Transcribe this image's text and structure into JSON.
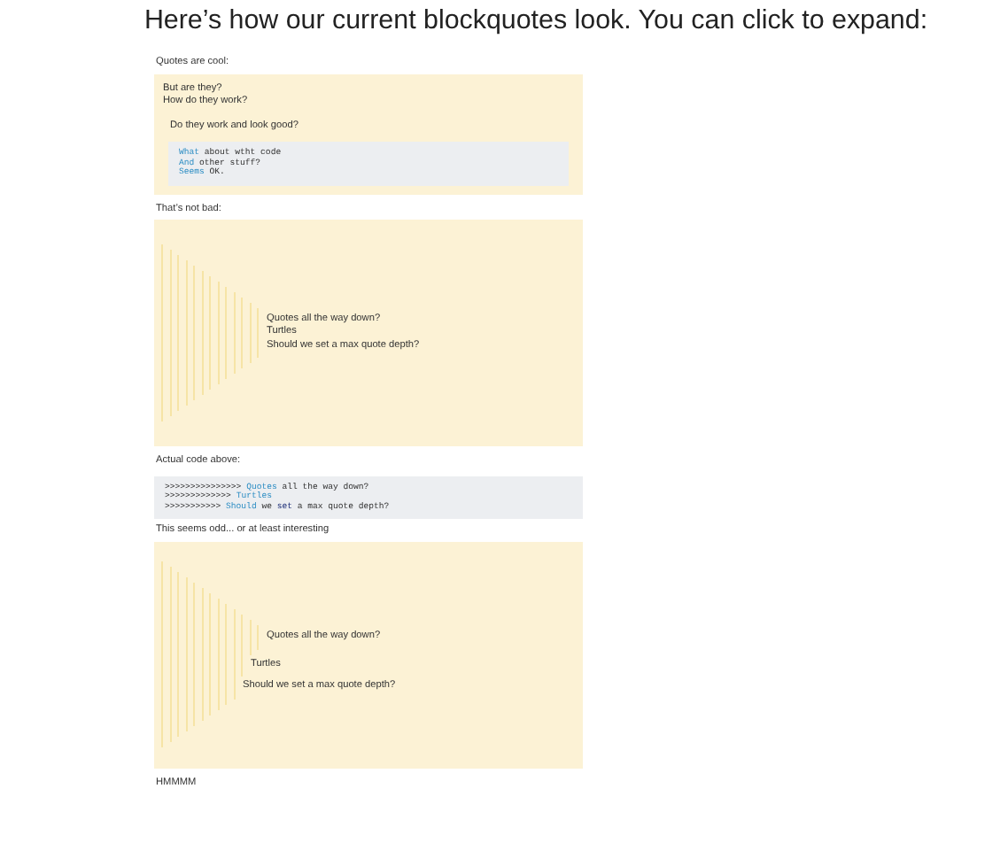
{
  "heading": "Here’s how our current blockquotes look. You can click to expand:",
  "content": [
    {
      "kind": "text",
      "text": "Quotes are cool:"
    },
    {
      "kind": "quote",
      "children": [
        {
          "kind": "text",
          "text": "But are they?"
        },
        {
          "kind": "text",
          "text": "How do they work?"
        },
        {
          "kind": "quote",
          "children": [
            {
              "kind": "text",
              "text": "Do they work and look good?"
            },
            {
              "kind": "code",
              "lines": [
                [
                  {
                    "kind": "keyword",
                    "text": "What"
                  },
                  {
                    "kind": "plain",
                    "text": " about wtht code"
                  }
                ],
                [
                  {
                    "kind": "keyword",
                    "text": "And"
                  },
                  {
                    "kind": "plain",
                    "text": " other stuff?"
                  }
                ],
                [
                  {
                    "kind": "keyword",
                    "text": "Seems"
                  },
                  {
                    "kind": "plain",
                    "text": " OK."
                  }
                ]
              ]
            }
          ]
        }
      ]
    },
    {
      "kind": "text",
      "text": "That’s not bad:"
    },
    {
      "kind": "quote",
      "children": [
        {
          "kind": "quote",
          "children": [
            {
              "kind": "quote",
              "children": [
                {
                  "kind": "quote",
                  "children": [
                    {
                      "kind": "quote",
                      "children": [
                        {
                          "kind": "quote",
                          "children": [
                            {
                              "kind": "quote",
                              "children": [
                                {
                                  "kind": "quote",
                                  "children": [
                                    {
                                      "kind": "quote",
                                      "children": [
                                        {
                                          "kind": "quote",
                                          "children": [
                                            {
                                              "kind": "quote",
                                              "children": [
                                                {
                                                  "kind": "quote",
                                                  "children": [
                                                    {
                                                      "kind": "quote",
                                                      "children": [
                                                        {
                                                          "kind": "quote",
                                                          "children": [
                                                            {
                                                              "kind": "text",
                                                              "text": "Quotes all the way down?"
                                                            },
                                                            {
                                                              "kind": "text",
                                                              "text": "Turtles"
                                                            },
                                                            {
                                                              "kind": "text",
                                                              "text": "Should we set a max quote depth?"
                                                            }
                                                          ]
                                                        }
                                                      ]
                                                    }
                                                  ]
                                                }
                                              ]
                                            }
                                          ]
                                        }
                                      ]
                                    }
                                  ]
                                }
                              ]
                            }
                          ]
                        }
                      ]
                    }
                  ]
                }
              ]
            }
          ]
        }
      ]
    },
    {
      "kind": "text",
      "text": "Actual code above:"
    },
    {
      "kind": "code",
      "lines": [
        [
          {
            "kind": "plain",
            "text": ">>>>>>>>>>>>>>> "
          },
          {
            "kind": "keyword",
            "text": "Quotes"
          },
          {
            "kind": "plain",
            "text": " all the way down?"
          }
        ],
        [
          {
            "kind": "plain",
            "text": ">>>>>>>>>>>>> "
          },
          {
            "kind": "keyword",
            "text": "Turtles"
          }
        ],
        [
          {
            "kind": "plain",
            "text": ">>>>>>>>>>> "
          },
          {
            "kind": "keyword",
            "text": "Should"
          },
          {
            "kind": "plain",
            "text": " we "
          },
          {
            "kind": "builtin",
            "text": "set"
          },
          {
            "kind": "plain",
            "text": " a max quote depth?"
          }
        ]
      ]
    },
    {
      "kind": "text",
      "text": "This seems odd... or at least interesting"
    },
    {
      "kind": "quote",
      "children": [
        {
          "kind": "quote",
          "children": [
            {
              "kind": "quote",
              "children": [
                {
                  "kind": "quote",
                  "children": [
                    {
                      "kind": "quote",
                      "children": [
                        {
                          "kind": "quote",
                          "children": [
                            {
                              "kind": "quote",
                              "children": [
                                {
                                  "kind": "quote",
                                  "children": [
                                    {
                                      "kind": "quote",
                                      "children": [
                                        {
                                          "kind": "quote",
                                          "children": [
                                            {
                                              "kind": "quote",
                                              "children": [
                                                {
                                                  "kind": "quote",
                                                  "children": [
                                                    {
                                                      "kind": "quote",
                                                      "children": [
                                                        {
                                                          "kind": "quote",
                                                          "children": [
                                                            {
                                                              "kind": "text",
                                                              "text": "Quotes all the way down?"
                                                            }
                                                          ]
                                                        }
                                                      ]
                                                    },
                                                    {
                                                      "kind": "text",
                                                      "text": "Turtles"
                                                    }
                                                  ]
                                                },
                                                {
                                                  "kind": "text",
                                                  "text": "Should we set a max quote depth?"
                                                }
                                              ]
                                            }
                                          ]
                                        }
                                      ]
                                    }
                                  ]
                                }
                              ]
                            }
                          ]
                        }
                      ]
                    }
                  ]
                }
              ]
            }
          ]
        }
      ]
    },
    {
      "kind": "text",
      "text": "HMMMM"
    }
  ]
}
